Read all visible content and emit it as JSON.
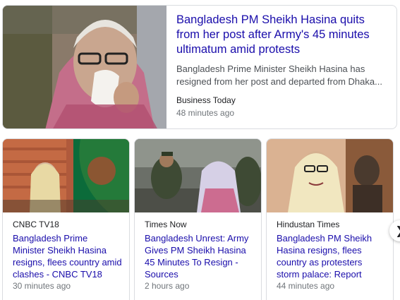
{
  "top_story": {
    "headline": "Bangladesh PM Sheikh Hasina quits from her post after Army's 45 minutes ultimatum amid protests",
    "snippet": "Bangladesh Prime Minister Sheikh Hasina has resigned from her post and departed from Dhaka...",
    "source": "Business Today",
    "time": "48 minutes ago"
  },
  "stories": [
    {
      "source": "CNBC TV18",
      "headline": "Bangladesh Prime Minister Sheikh Hasina resigns, flees country amid clashes - CNBC TV18",
      "time": "30 minutes ago"
    },
    {
      "source": "Times Now",
      "headline": "Bangladesh Unrest: Army Gives PM Sheikh Hasina 45 Minutes To Resign - Sources",
      "time": "2 hours ago"
    },
    {
      "source": "Hindustan Times",
      "headline": "Bangladesh PM Sheikh Hasina resigns, flees country as protesters storm palace: Report",
      "time": "44 minutes ago"
    }
  ],
  "navigation": {
    "next_icon": "chevron-right-icon",
    "next_glyph": "❯"
  },
  "colors": {
    "headline": "#1a0dab",
    "snippet": "#4d5156",
    "meta": "#70757a",
    "border": "#dadce0"
  }
}
